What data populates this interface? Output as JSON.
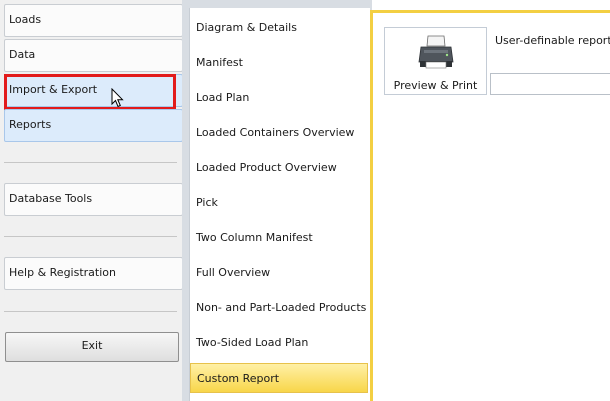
{
  "nav": {
    "loads": "Loads",
    "data": "Data",
    "import_export": "Import & Export",
    "reports": "Reports",
    "database_tools": "Database Tools",
    "help_registration": "Help & Registration",
    "exit": "Exit"
  },
  "report_list": [
    "Diagram & Details",
    "Manifest",
    "Load Plan",
    "Loaded Containers Overview",
    "Loaded Product Overview",
    "Pick",
    "Two Column Manifest",
    "Full Overview",
    "Non- and Part-Loaded Products",
    "Two-Sided Load Plan",
    "Custom Report"
  ],
  "selected_report": "Custom Report",
  "preview_print": {
    "label": "Preview & Print",
    "icon": "printer-icon"
  },
  "user_reports": {
    "label": "User-definable reports",
    "value": ""
  },
  "colors": {
    "highlight_red": "#e21b1b",
    "selected_yellow": "#f8d64a",
    "nav_selected_blue": "#dcebfb"
  }
}
